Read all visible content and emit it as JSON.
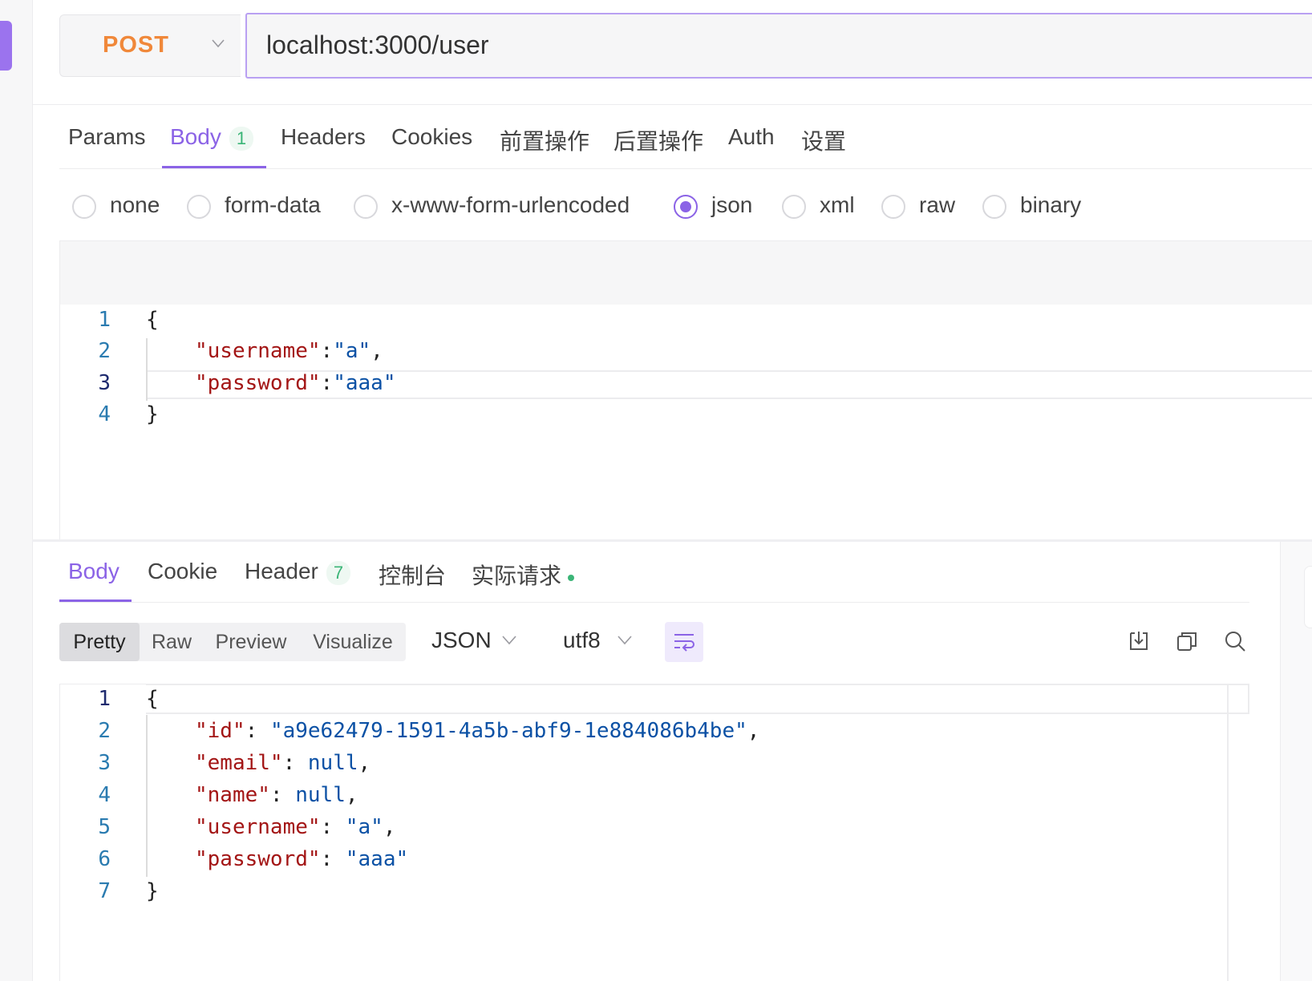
{
  "request": {
    "method": "POST",
    "url": "localhost:3000/user",
    "tabs": [
      {
        "label": "Params"
      },
      {
        "label": "Body",
        "badge": "1"
      },
      {
        "label": "Headers"
      },
      {
        "label": "Cookies"
      },
      {
        "label": "前置操作"
      },
      {
        "label": "后置操作"
      },
      {
        "label": "Auth"
      },
      {
        "label": "设置"
      }
    ],
    "active_tab": "Body",
    "body_types": [
      "none",
      "form-data",
      "x-www-form-urlencoded",
      "json",
      "xml",
      "raw",
      "binary"
    ],
    "selected_body_type": "json",
    "editor": {
      "line_numbers": [
        "1",
        "2",
        "3",
        "4"
      ],
      "lines": {
        "l1": "{",
        "l2_key": "\"username\"",
        "l2_sep": ":",
        "l2_val": "\"a\"",
        "l2_end": ",",
        "l3_key": "\"password\"",
        "l3_sep": ":",
        "l3_val": "\"aaa\"",
        "l4": "}"
      }
    }
  },
  "response": {
    "tabs": [
      {
        "label": "Body"
      },
      {
        "label": "Cookie"
      },
      {
        "label": "Header",
        "badge": "7"
      },
      {
        "label": "控制台"
      },
      {
        "label": "实际请求"
      }
    ],
    "active_tab": "Body",
    "view_modes": [
      "Pretty",
      "Raw",
      "Preview",
      "Visualize"
    ],
    "active_view_mode": "Pretty",
    "format": "JSON",
    "encoding": "utf8",
    "icons": [
      "wrap-lines-icon",
      "download-icon",
      "copy-icon",
      "search-icon"
    ],
    "editor": {
      "line_numbers": [
        "1",
        "2",
        "3",
        "4",
        "5",
        "6",
        "7"
      ],
      "lines": {
        "l1": "{",
        "l2_key": "\"id\"",
        "l2_val": "\"a9e62479-1591-4a5b-abf9-1e884086b4be\"",
        "l3_key": "\"email\"",
        "l3_val": "null",
        "l4_key": "\"name\"",
        "l4_val": "null",
        "l5_key": "\"username\"",
        "l5_val": "\"a\"",
        "l6_key": "\"password\"",
        "l6_val": "\"aaa\"",
        "l7": "}",
        "sep": ": ",
        "comma": ","
      }
    }
  },
  "colors": {
    "accent": "#8b63e6",
    "method": "#f0883a",
    "json_key": "#a31515",
    "json_value": "#0b51a5",
    "badge_green": "#3bb577"
  }
}
